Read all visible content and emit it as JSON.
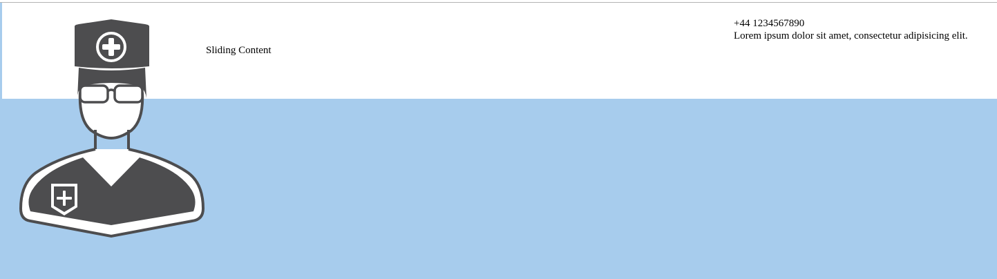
{
  "header": {
    "sliding_text": "Sliding Content",
    "phone": "+44 1234567890",
    "tagline": "Lorem ipsum dolor sit amet, consectetur adipisicing elit."
  },
  "hero": {
    "icon": "doctor-icon"
  },
  "colors": {
    "band": "#a7cced",
    "icon": "#4d4d4f",
    "header_bg": "#ffffff"
  }
}
